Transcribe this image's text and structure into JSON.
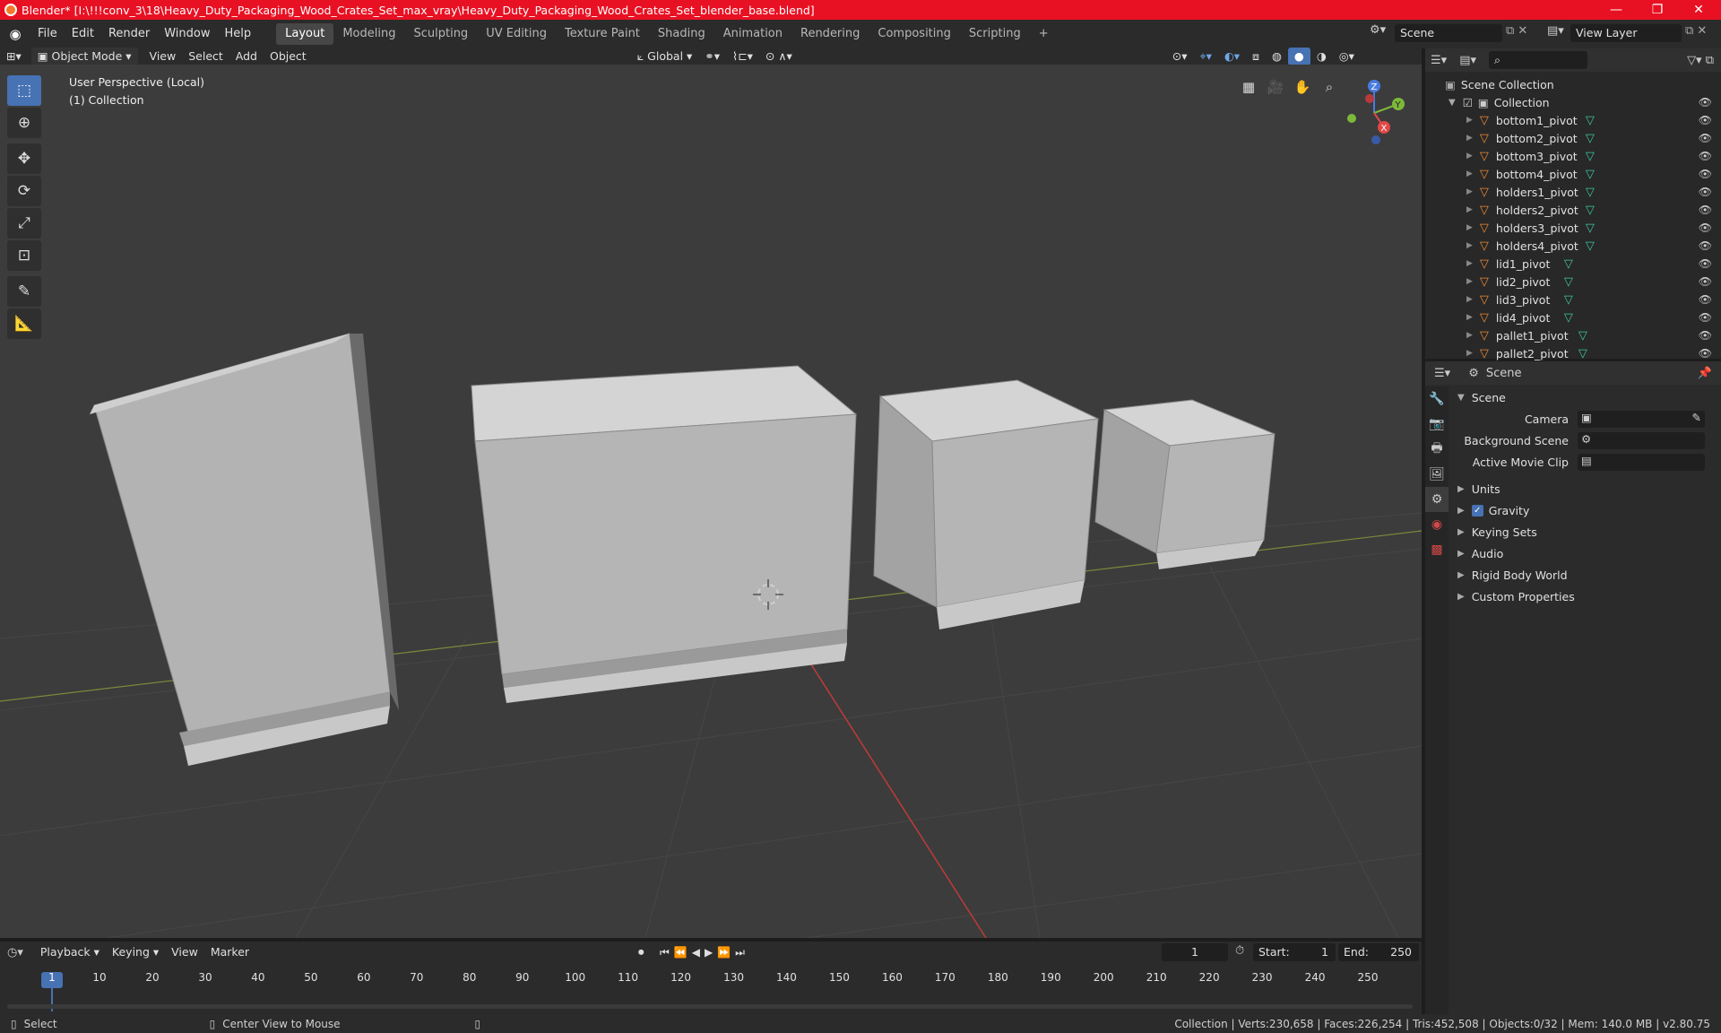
{
  "window": {
    "title": "Blender* [I:\\!!!conv_3\\18\\Heavy_Duty_Packaging_Wood_Crates_Set_max_vray\\Heavy_Duty_Packaging_Wood_Crates_Set_blender_base.blend]",
    "controls": {
      "minimize": "—",
      "maximize": "❐",
      "close": "✕"
    }
  },
  "menus": [
    "File",
    "Edit",
    "Render",
    "Window",
    "Help"
  ],
  "workspaces": [
    "Layout",
    "Modeling",
    "Sculpting",
    "UV Editing",
    "Texture Paint",
    "Shading",
    "Animation",
    "Rendering",
    "Compositing",
    "Scripting"
  ],
  "workspace_add": "+",
  "scene_name": "Scene",
  "view_layer_name": "View Layer",
  "viewport_header": {
    "mode": "Object Mode",
    "menus": [
      "View",
      "Select",
      "Add",
      "Object"
    ],
    "transform_orientation": "Global"
  },
  "viewport_overlay": {
    "perspective": "User Perspective (Local)",
    "collection": "(1) Collection"
  },
  "gizmo_axes": {
    "z": "Z",
    "y": "Y",
    "x": "X"
  },
  "outliner": {
    "root": "Scene Collection",
    "collection": "Collection",
    "items": [
      "bottom1_pivot",
      "bottom2_pivot",
      "bottom3_pivot",
      "bottom4_pivot",
      "holders1_pivot",
      "holders2_pivot",
      "holders3_pivot",
      "holders4_pivot",
      "lid1_pivot",
      "lid2_pivot",
      "lid3_pivot",
      "lid4_pivot",
      "pallet1_pivot",
      "pallet2_pivot"
    ]
  },
  "properties": {
    "header": "Scene",
    "panel_title": "Scene",
    "fields": [
      "Camera",
      "Background Scene",
      "Active Movie Clip"
    ],
    "subpanels": [
      "Units",
      "Gravity",
      "Keying Sets",
      "Audio",
      "Rigid Body World",
      "Custom Properties"
    ]
  },
  "timeline": {
    "menus": [
      "Playback",
      "Keying",
      "View",
      "Marker"
    ],
    "current_frame": "1",
    "start_label": "Start:",
    "start": "1",
    "end_label": "End:",
    "end": "250",
    "ticks": [
      "1",
      "10",
      "20",
      "30",
      "40",
      "50",
      "60",
      "70",
      "80",
      "90",
      "100",
      "110",
      "120",
      "130",
      "140",
      "150",
      "160",
      "170",
      "180",
      "190",
      "200",
      "210",
      "220",
      "230",
      "240",
      "250"
    ]
  },
  "statusbar": {
    "select": "Select",
    "center_view": "Center View to Mouse",
    "stats": "Collection | Verts:230,658 | Faces:226,254 | Tris:452,508 | Objects:0/32 | Mem: 140.0 MB | v2.80.75"
  },
  "colors": {
    "title_bar": "#e81123",
    "accent": "#4772b3",
    "object_icon": "#ee8a30",
    "mesh_icon": "#3dc6a0"
  }
}
